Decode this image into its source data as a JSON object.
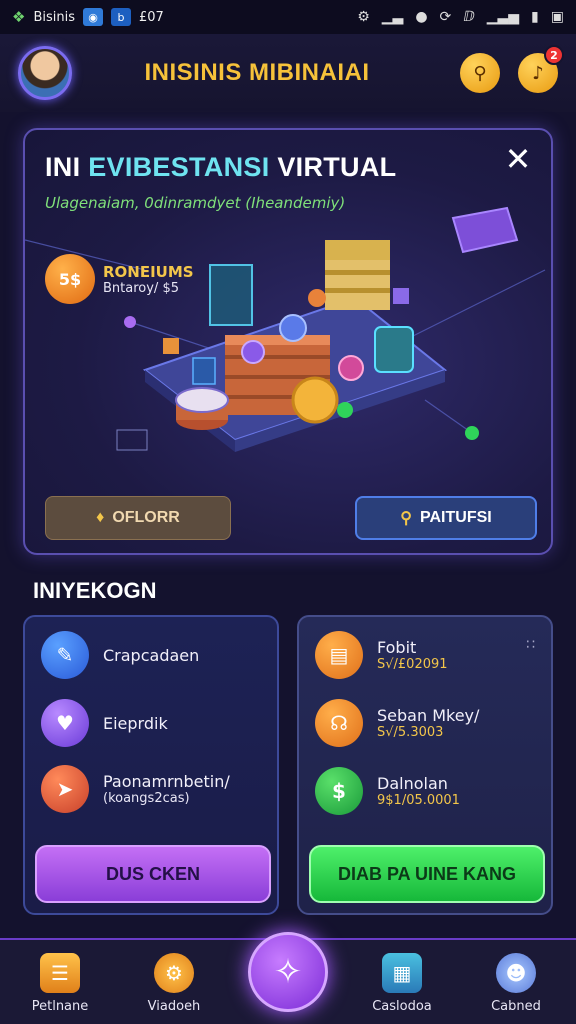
{
  "status_bar": {
    "app_name": "Bisinis",
    "time": "£07"
  },
  "header": {
    "title": "INISINIS MIBINAIAI",
    "notification_badge": "2"
  },
  "hero": {
    "title_part1": "INI ",
    "title_part2": "EVIBESTANSI",
    "title_part3": " VIRTUAL",
    "subtitle": "Ulagenaiam, 0dinramdyet (Iheandemiy)",
    "promo_title": "RONEIUMS",
    "promo_sub": "Bntaroy/ $5",
    "promo_icon_text": "5$",
    "orders_button": "OFLORR",
    "partner_button": "PAITUFSI"
  },
  "section": {
    "title": "INIYEKOGN"
  },
  "left_card": {
    "items": [
      {
        "label": "Crapcadaen",
        "icon": "pencil-icon"
      },
      {
        "label": "Eieprdik",
        "icon": "heart-card-icon"
      },
      {
        "label": "Paonamrnbetin/",
        "sub": "(koangs2cas)",
        "icon": "rocket-icon"
      }
    ],
    "button": "DUS CKEN"
  },
  "right_card": {
    "items": [
      {
        "label": "Fobit",
        "value": "S√/£02091",
        "icon": "book-icon"
      },
      {
        "label": "Seban Mkey/",
        "value": "S√/5.3003",
        "icon": "headset-icon"
      },
      {
        "label": "Dalnolan",
        "value": "9$1/05.0001",
        "icon": "money-icon"
      }
    ],
    "button": "DIAB PA UINE KANG"
  },
  "bottom_nav": {
    "items": [
      "Petlnane",
      "Viadoeh",
      "Caslodoa",
      "Cabned"
    ]
  },
  "colors": {
    "accent_gold": "#f3c64a",
    "accent_purple": "#9b4fe8",
    "accent_green": "#1fcf48",
    "background": "#14122e"
  }
}
